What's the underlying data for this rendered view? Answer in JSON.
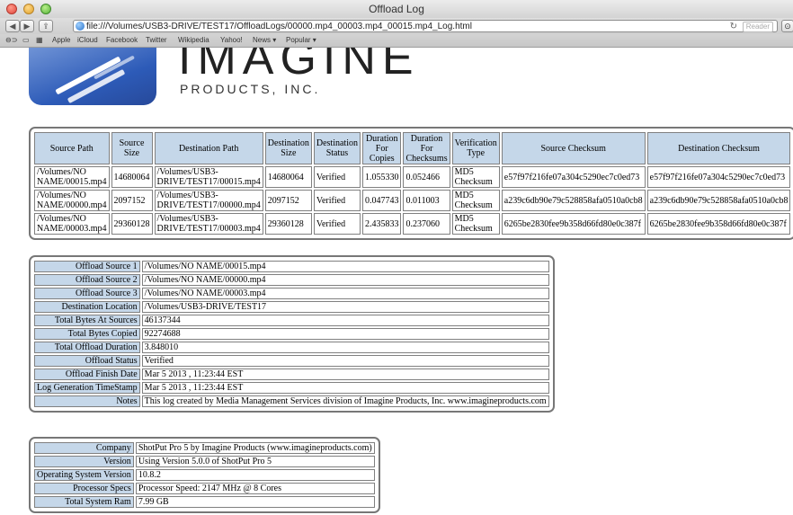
{
  "window": {
    "title": "Offload Log",
    "url": "file:///Volumes/USB3-DRIVE/TEST17/OffloadLogs/00000.mp4_00003.mp4_00015.mp4_Log.html",
    "reader_label": "Reader"
  },
  "bookmarks": [
    "Apple",
    "iCloud",
    "Facebook",
    "Twitter",
    "Wikipedia",
    "Yahoo!",
    "News ▾",
    "Popular ▾"
  ],
  "logo": {
    "brand": "IMAGINE",
    "company": "PRODUCTS, INC."
  },
  "offload_table": {
    "headers": [
      "Source Path",
      "Source Size",
      "Destination Path",
      "Destination Size",
      "Destination Status",
      "Duration For Copies",
      "Duration For Checksums",
      "Verification Type",
      "Source Checksum",
      "Destination Checksum"
    ],
    "rows": [
      [
        "/Volumes/NO NAME/00015.mp4",
        "14680064",
        "/Volumes/USB3-DRIVE/TEST17/00015.mp4",
        "14680064",
        "Verified",
        "1.055330",
        "0.052466",
        "MD5 Checksum",
        "e57f97f216fe07a304c5290ec7c0ed73",
        "e57f97f216fe07a304c5290ec7c0ed73"
      ],
      [
        "/Volumes/NO NAME/00000.mp4",
        "2097152",
        "/Volumes/USB3-DRIVE/TEST17/00000.mp4",
        "2097152",
        "Verified",
        "0.047743",
        "0.011003",
        "MD5 Checksum",
        "a239c6db90e79c528858afa0510a0cb8",
        "a239c6db90e79c528858afa0510a0cb8"
      ],
      [
        "/Volumes/NO NAME/00003.mp4",
        "29360128",
        "/Volumes/USB3-DRIVE/TEST17/00003.mp4",
        "29360128",
        "Verified",
        "2.435833",
        "0.237060",
        "MD5 Checksum",
        "6265be2830fee9b358d66fd80e0c387f",
        "6265be2830fee9b358d66fd80e0c387f"
      ]
    ]
  },
  "summary": [
    {
      "label": "Offload Source 1",
      "value": "/Volumes/NO NAME/00015.mp4"
    },
    {
      "label": "Offload Source 2",
      "value": "/Volumes/NO NAME/00000.mp4"
    },
    {
      "label": "Offload Source 3",
      "value": "/Volumes/NO NAME/00003.mp4"
    },
    {
      "label": "Destination Location",
      "value": "/Volumes/USB3-DRIVE/TEST17"
    },
    {
      "label": "Total Bytes At Sources",
      "value": "46137344"
    },
    {
      "label": "Total Bytes Copied",
      "value": "92274688"
    },
    {
      "label": "Total Offload Duration",
      "value": "3.848010"
    },
    {
      "label": "Offload Status",
      "value": "Verified"
    },
    {
      "label": "Offload Finish Date",
      "value": "Mar 5 2013 , 11:23:44 EST"
    },
    {
      "label": "Log Generation TimeStamp",
      "value": "Mar 5 2013 , 11:23:44 EST"
    },
    {
      "label": "Notes",
      "value": "This log created by Media Management Services division of Imagine Products, Inc. www.imagineproducts.com"
    }
  ],
  "system": [
    {
      "label": "Company",
      "value": "ShotPut Pro 5 by Imagine Products (www.imagineproducts.com)"
    },
    {
      "label": "Version",
      "value": "Using Version 5.0.0 of ShotPut Pro 5"
    },
    {
      "label": "Operating System Version",
      "value": "10.8.2"
    },
    {
      "label": "Processor Specs",
      "value": "Processor Speed: 2147 MHz @ 8 Cores"
    },
    {
      "label": "Total System Ram",
      "value": "7.99 GB"
    }
  ],
  "colors": {
    "header_cell": "#c5d7e9",
    "border": "#808080",
    "logo_blue": "#2d5bb8"
  }
}
